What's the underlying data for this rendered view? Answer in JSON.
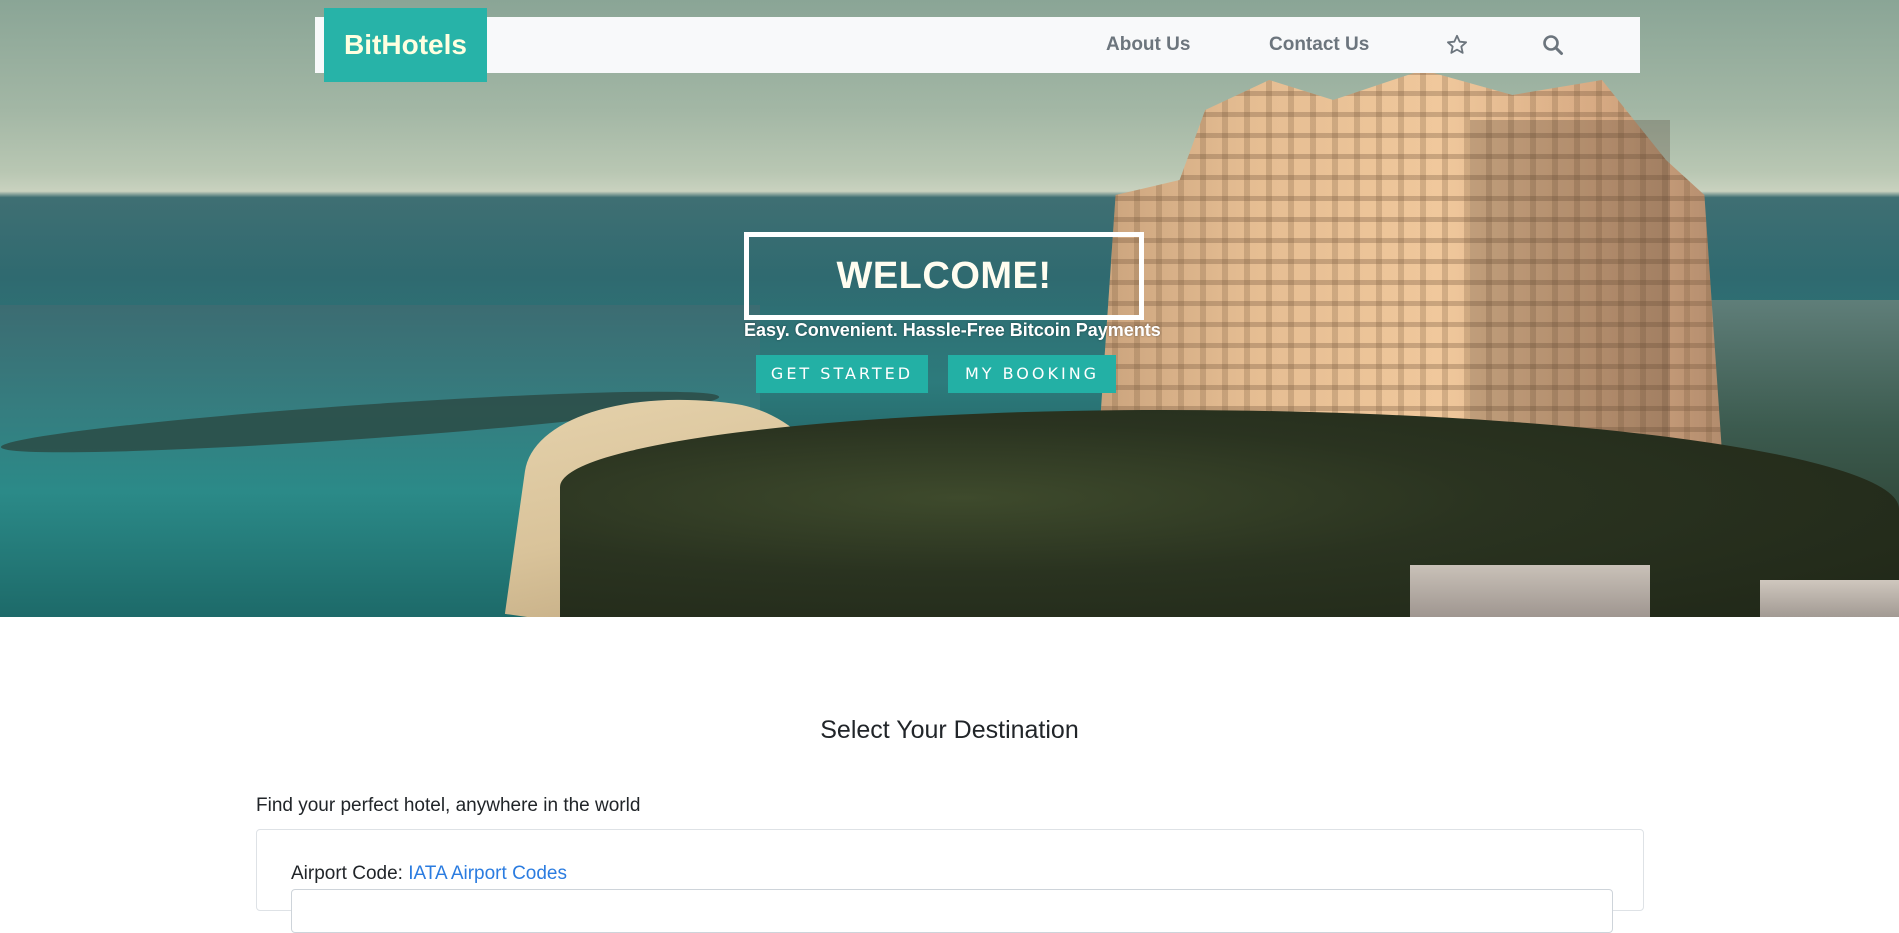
{
  "navbar": {
    "brand": "BitHotels",
    "links": [
      {
        "label": "About Us"
      },
      {
        "label": "Contact Us"
      }
    ],
    "icons": [
      "star-icon",
      "search-icon"
    ]
  },
  "hero": {
    "welcome": "WELCOME!",
    "tagline": "Easy. Convenient. Hassle-Free Bitcoin Payments",
    "buttons": {
      "get_started": "GET STARTED",
      "my_booking": "MY BOOKING"
    }
  },
  "main": {
    "section_title": "Select Your Destination",
    "lead": "Find your perfect hotel, anywhere in the world",
    "airport_label": "Airport Code:",
    "airport_link": "IATA Airport Codes",
    "airport_input": {
      "value": "",
      "placeholder": ""
    }
  },
  "colors": {
    "brand_teal": "#27b3a8",
    "button_teal": "#23b0a5",
    "link_blue": "#2b7ce0",
    "navbar_bg": "#f8f9fa"
  }
}
